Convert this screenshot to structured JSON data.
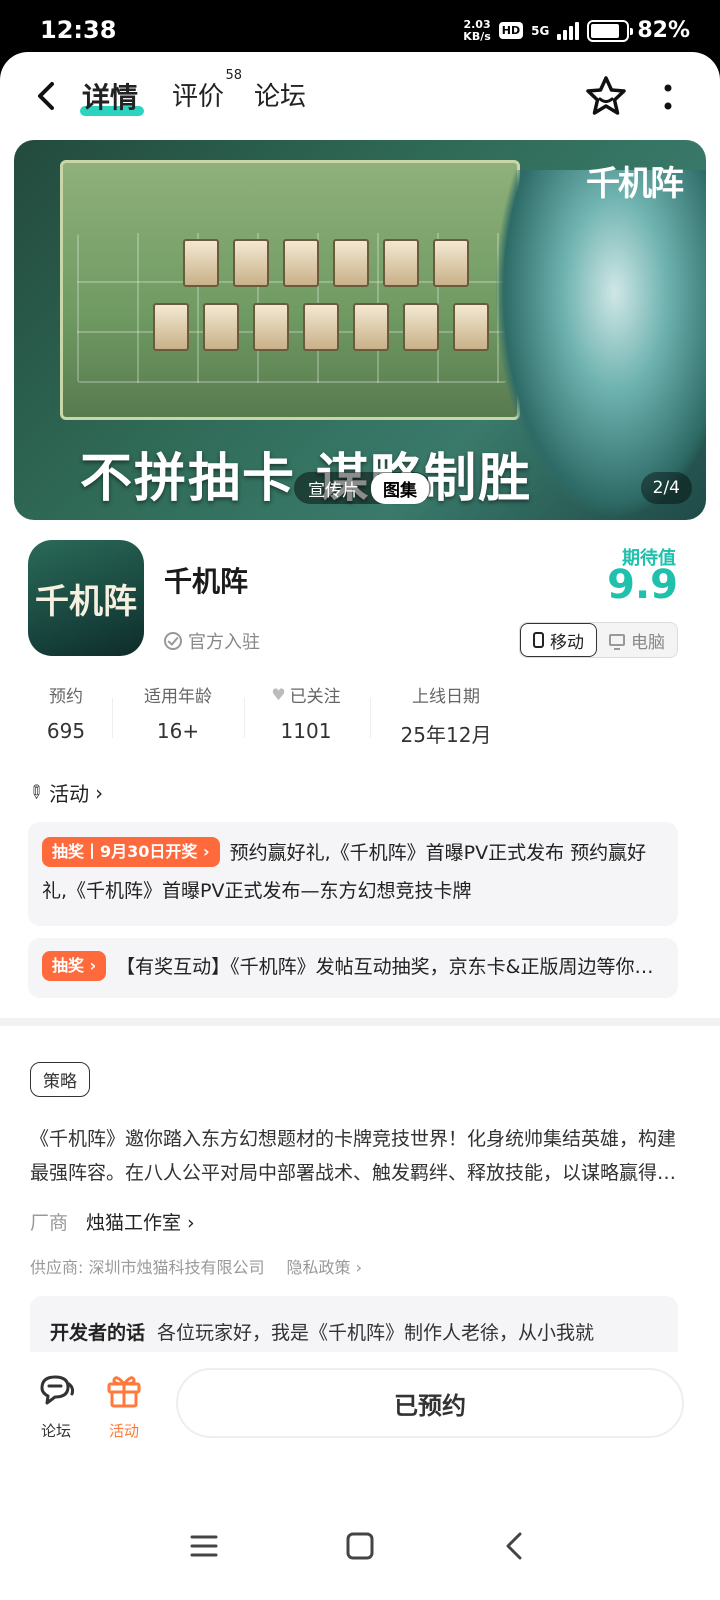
{
  "status": {
    "time": "12:38",
    "net_speed_value": "2.03",
    "net_speed_unit": "KB/s",
    "hd": "HD",
    "network": "5G",
    "battery_level": 0.82,
    "battery_text": "82%"
  },
  "nav": {
    "tabs": [
      {
        "label": "详情"
      },
      {
        "label": "评价",
        "count": "58"
      },
      {
        "label": "论坛"
      }
    ]
  },
  "banner": {
    "logo_text": "千机阵",
    "slogan": "不拼抽卡 谋略制胜",
    "toggle": [
      "宣传片",
      "图集"
    ],
    "page_indicator": "2/4"
  },
  "app": {
    "icon_text": "千机阵",
    "name": "千机阵",
    "official": "官方入驻",
    "expect_label": "期待值",
    "expect_value": "9.9",
    "platforms": [
      "移动",
      "电脑"
    ]
  },
  "stats": [
    {
      "label": "预约",
      "value": "695"
    },
    {
      "label": "适用年龄",
      "value": "16+"
    },
    {
      "label": "已关注",
      "value": "1101"
    },
    {
      "label": "上线日期",
      "value": "25年12月"
    }
  ],
  "activity": {
    "header": "活动",
    "items": [
      {
        "badge": "抽奖丨9月30日开奖 ›",
        "text": "预约赢好礼,《千机阵》首曝PV正式发布 预约赢好礼,《千机阵》首曝PV正式发布—东方幻想竞技卡牌"
      },
      {
        "badge": "抽奖 ›",
        "text": "【有奖互动】《千机阵》发帖互动抽奖，京东卡&正版周边等你来拿"
      }
    ]
  },
  "details": {
    "tag": "策略",
    "description": "《千机阵》邀你踏入东方幻想题材的卡牌竞技世界！化身统帅集结英雄，构建最强阵容。在八人公平对局中部署战术、触发羁绊、释放技能，以谋略赢得胜利。",
    "vendor_label": "厂商",
    "vendor_name": "烛猫工作室 ›",
    "supplier": "供应商: 深圳市烛猫科技有限公司",
    "privacy": "隐私政策 ›",
    "dev_title": "开发者的话",
    "dev_text": "各位玩家好，我是《千机阵》制作人老徐，从小我就"
  },
  "bottom": {
    "forum_label": "论坛",
    "activity_label": "活动",
    "reserve_label": "已预约"
  },
  "colors": {
    "accent": "#2cd3c0",
    "expect": "#1fc0ac",
    "badge": "#ff6a3d",
    "active_bottom": "#ff7a3a"
  }
}
